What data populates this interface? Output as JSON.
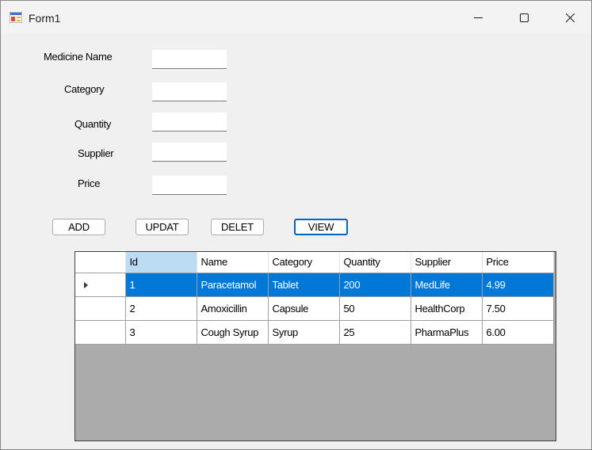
{
  "window": {
    "title": "Form1",
    "icon": "form-icon",
    "controls": [
      "minimize-icon",
      "maximize-icon",
      "close-icon"
    ]
  },
  "form": {
    "labels": {
      "medicine_name": "Medicine Name",
      "category": "Category",
      "quantity": "Quantity",
      "supplier": "Supplier",
      "price": "Price"
    },
    "values": {
      "medicine_name": "",
      "category": "",
      "quantity": "",
      "supplier": "",
      "price": ""
    }
  },
  "buttons": {
    "add": "ADD",
    "update": "UPDAT",
    "delete": "DELET",
    "view": "VIEW"
  },
  "grid": {
    "columns": [
      "Id",
      "Name",
      "Category",
      "Quantity",
      "Supplier",
      "Price"
    ],
    "rows": [
      [
        "1",
        "Paracetamol",
        "Tablet",
        "200",
        "MedLife",
        "4.99"
      ],
      [
        "2",
        "Amoxicillin",
        "Capsule",
        "50",
        "HealthCorp",
        "7.50"
      ],
      [
        "3",
        "Cough Syrup",
        "Syrup",
        "25",
        "PharmaPlus",
        "6.00"
      ]
    ],
    "selected_row": 1,
    "colors": {
      "selection": "#0078d7",
      "sorted_header": "#bcdcf4",
      "empty_area": "#ababab"
    }
  }
}
